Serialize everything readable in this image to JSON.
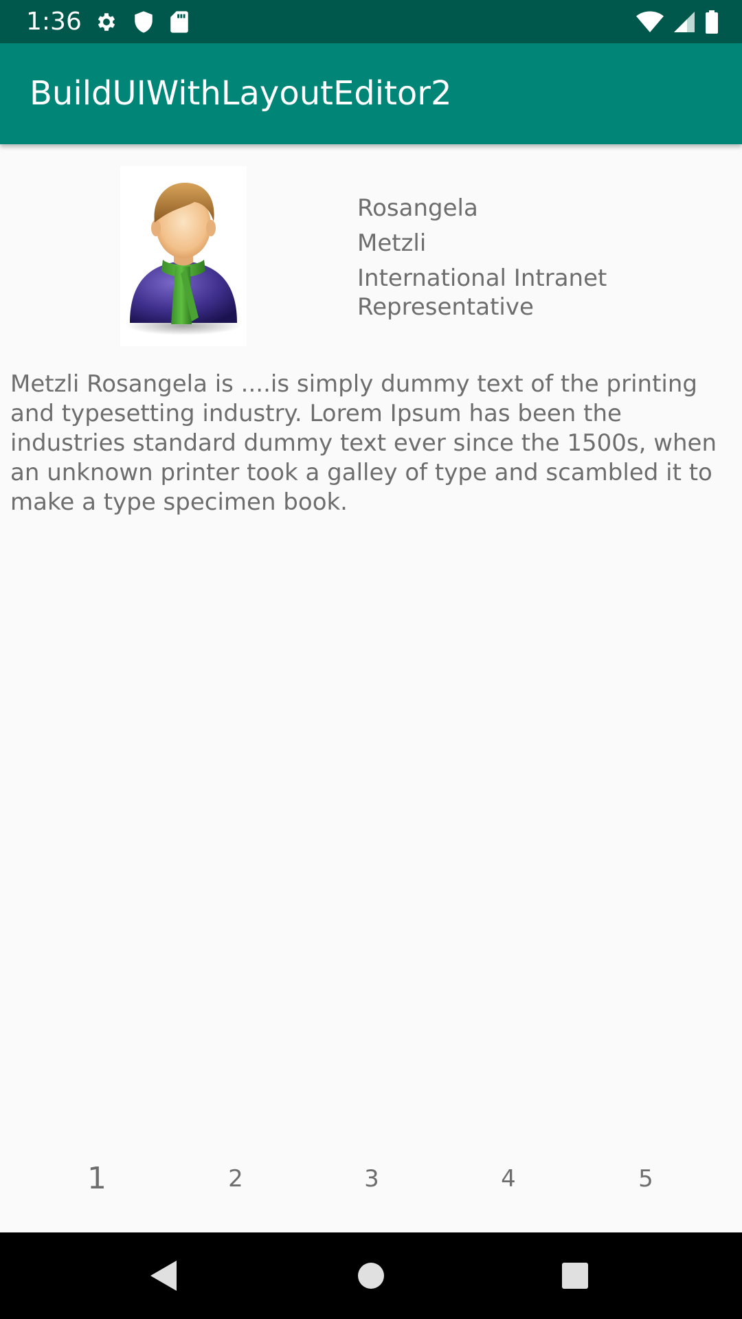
{
  "status_bar": {
    "time": "1:36",
    "left_icons": [
      "gear-icon",
      "shield-icon",
      "sd-card-icon"
    ],
    "right_icons": [
      "wifi-icon",
      "cellular-icon",
      "battery-icon"
    ],
    "background": "#00574b"
  },
  "app_bar": {
    "title": "BuildUIWithLayoutEditor2",
    "background": "#008577"
  },
  "profile": {
    "avatar_icon": "person-avatar-icon",
    "first_name": "Rosangela",
    "last_name": "Metzli",
    "title": "International Intranet Representative"
  },
  "description": "Metzli Rosangela is ....is simply dummy text of the printing and typesetting industry. Lorem Ipsum has been the industries standard dummy text ever since the 1500s, when an unknown printer took a galley of type and scambled it to make a type specimen book.",
  "pager": {
    "pages": [
      "1",
      "2",
      "3",
      "4",
      "5"
    ],
    "selected": "1"
  },
  "nav_bar": {
    "buttons": [
      "back-icon",
      "home-icon",
      "recents-icon"
    ]
  }
}
